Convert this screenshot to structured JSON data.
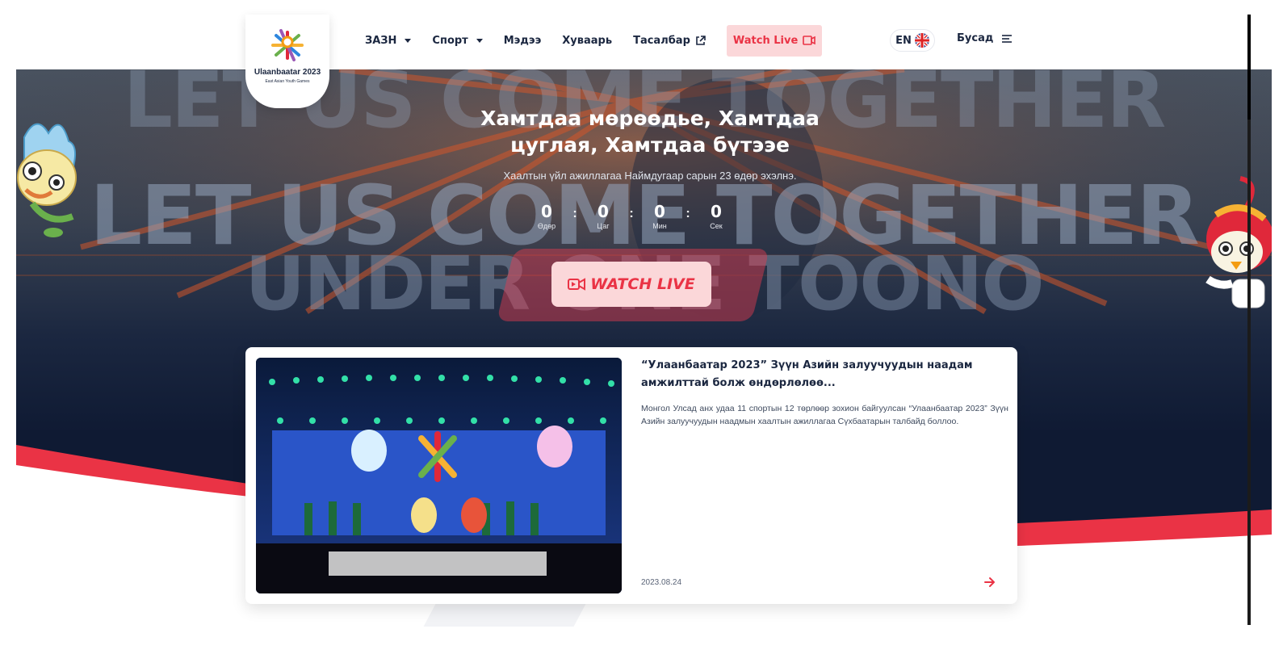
{
  "colors": {
    "navy": "#1b2740",
    "accent_red": "#ea3345",
    "live_pink_bg": "#fbd7d9",
    "white": "#ffffff"
  },
  "logo": {
    "title": "Ulaanbaatar 2023",
    "subtitle": "East Asian Youth Games"
  },
  "nav": {
    "items": [
      {
        "label": "ЗАЗН",
        "has_dropdown": true
      },
      {
        "label": "Спорт",
        "has_dropdown": true
      },
      {
        "label": "Мэдээ"
      },
      {
        "label": "Хуваарь"
      },
      {
        "label": "Тасалбар",
        "icon": "external-link-icon"
      },
      {
        "label": "Watch Live",
        "icon": "video-camera-icon"
      }
    ],
    "language": "EN",
    "language_icon": "uk-flag-icon",
    "more_label": "Бусад",
    "more_icon": "menu-icon"
  },
  "hero": {
    "background_text": [
      "LET US COME TOGETHER",
      "LET US COME TOGETHER",
      "UNDER ONE TOONO"
    ],
    "title": "Хамтдаа мөрөөдье, Хамтдаа цуглая, Хамтдаа бүтээе",
    "subtitle": "Хаалтын үйл ажиллагаа Наймдугаар сарын 23 өдөр эхэлнэ.",
    "countdown": [
      {
        "value": "0",
        "label": "Өдөр"
      },
      {
        "value": "0",
        "label": "Цаг"
      },
      {
        "value": "0",
        "label": "Мин"
      },
      {
        "value": "0",
        "label": "Сек"
      }
    ],
    "separator": ":",
    "watch_live_label": "WATCH LIVE"
  },
  "news": {
    "title": "“Улаанбаатар 2023” Зүүн Азийн залуучуудын наадам амжилттай болж өндөрлөлөө...",
    "description": "Монгол Улсад анх удаа 11 спортын 12 төрлөөр зохион байгуулсан “Улаанбаатар 2023” Зүүн Азийн залуучуудын наадмын хаалтын ажиллагаа Сүхбаатарын талбайд боллоо.",
    "date": "2023.08.24"
  }
}
